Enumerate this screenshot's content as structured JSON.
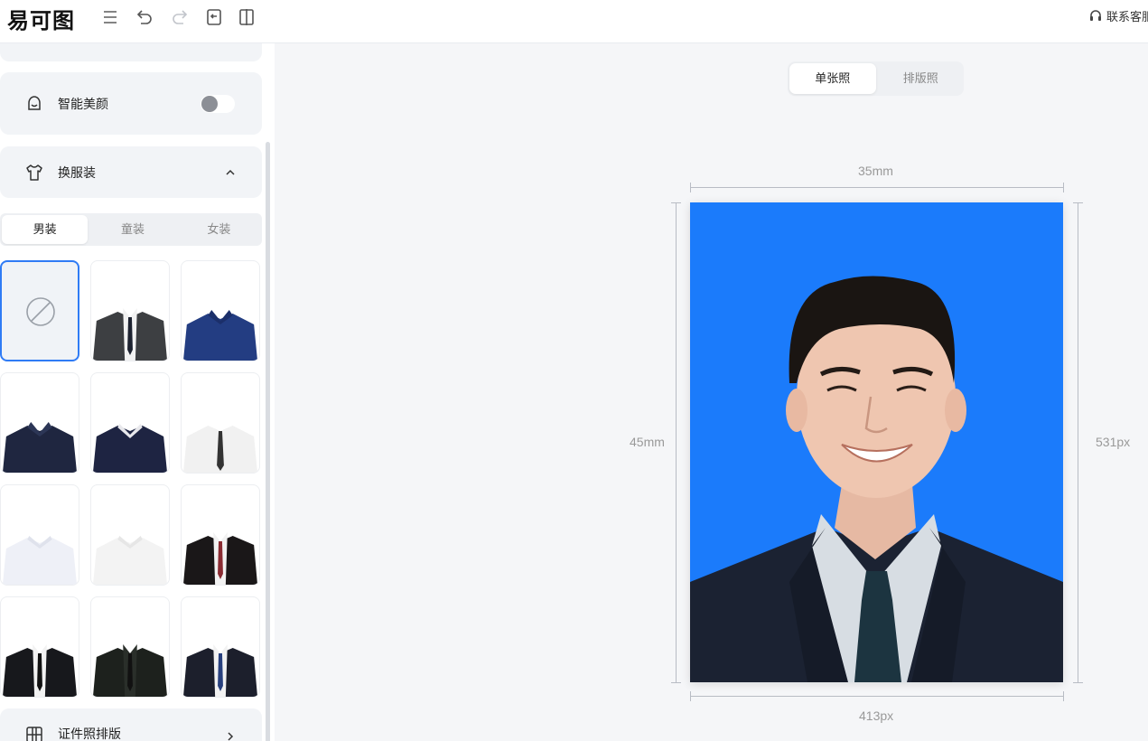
{
  "header": {
    "logo": "易可图",
    "contact": "联系客服",
    "icons": [
      "menu-icon",
      "undo-icon",
      "redo-icon",
      "import-icon",
      "compare-icon"
    ]
  },
  "sidebar": {
    "beauty_label": "智能美颜",
    "beauty_enabled": false,
    "clothes_label": "换服装",
    "clothes_tabs": [
      "男装",
      "童装",
      "女装"
    ],
    "clothes_active_tab": "男装",
    "layout_label": "证件照排版",
    "outfits": [
      "none",
      "gray-suit-dark-tie",
      "navy-polo",
      "navy-shirt",
      "navy-polo-white-collar",
      "white-shirt-black-tie",
      "white-polo",
      "white-shirt",
      "black-suit-red-tie",
      "black-suit-black-tie",
      "black-suit-green",
      "navy-suit-blue-tie"
    ]
  },
  "main": {
    "tabs": [
      "单张照",
      "排版照"
    ],
    "active_tab": "单张照",
    "width_mm": "35mm",
    "height_mm": "45mm",
    "width_px": "413px",
    "height_px": "531px",
    "background_color": "#1b7bfb"
  }
}
